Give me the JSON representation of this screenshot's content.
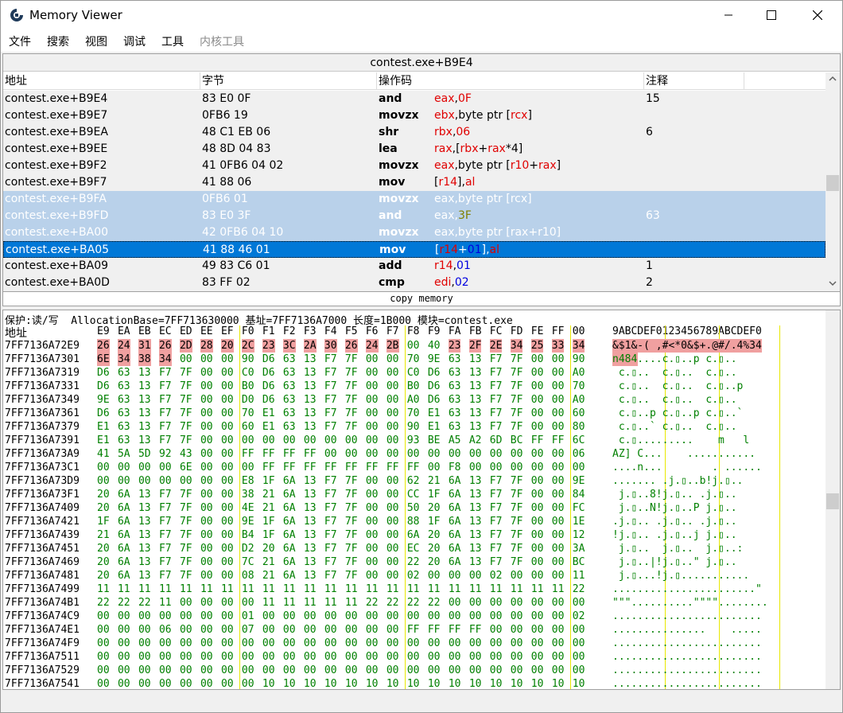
{
  "window": {
    "title": "Memory Viewer"
  },
  "menu": [
    "文件",
    "搜索",
    "视图",
    "调试",
    "工具",
    "内核工具"
  ],
  "disasm": {
    "address_header": "contest.exe+B9E4",
    "columns": [
      "地址",
      "字节",
      "操作码",
      "注释"
    ],
    "rows": [
      {
        "addr": "contest.exe+B9E4",
        "bytes": "83 E0 0F",
        "op": "and",
        "args": [
          [
            "eax",
            "reg"
          ],
          [
            ",",
            ""
          ],
          [
            "0F",
            "reg"
          ]
        ],
        "comment": "15",
        "state": ""
      },
      {
        "addr": "contest.exe+B9E7",
        "bytes": "0FB6 19",
        "op": "movzx",
        "args": [
          [
            "ebx",
            "reg"
          ],
          [
            ",byte ptr [",
            ""
          ],
          [
            "rcx",
            "reg"
          ],
          [
            "]",
            ""
          ]
        ],
        "comment": "",
        "state": ""
      },
      {
        "addr": "contest.exe+B9EA",
        "bytes": "48 C1 EB 06",
        "op": "shr",
        "args": [
          [
            "rbx",
            "reg"
          ],
          [
            ",",
            ""
          ],
          [
            "06",
            "reg"
          ]
        ],
        "comment": "6",
        "state": ""
      },
      {
        "addr": "contest.exe+B9EE",
        "bytes": "48 8D 04 83",
        "op": "lea",
        "args": [
          [
            "rax",
            "reg"
          ],
          [
            ",[",
            ""
          ],
          [
            "rbx",
            "reg"
          ],
          [
            "+",
            ""
          ],
          [
            "rax",
            "reg"
          ],
          [
            "*4]",
            ""
          ]
        ],
        "comment": "",
        "state": ""
      },
      {
        "addr": "contest.exe+B9F2",
        "bytes": "41 0FB6 04 02",
        "op": "movzx",
        "args": [
          [
            "eax",
            "reg"
          ],
          [
            ",byte ptr [",
            ""
          ],
          [
            "r10",
            "reg"
          ],
          [
            "+",
            ""
          ],
          [
            "rax",
            "reg"
          ],
          [
            "]",
            ""
          ]
        ],
        "comment": "",
        "state": ""
      },
      {
        "addr": "contest.exe+B9F7",
        "bytes": "41 88 06",
        "op": "mov",
        "args": [
          [
            "[",
            ""
          ],
          [
            "r14",
            "reg"
          ],
          [
            "],",
            ""
          ],
          [
            "al",
            "reg"
          ]
        ],
        "comment": "",
        "state": ""
      },
      {
        "addr": "contest.exe+B9FA",
        "bytes": "0FB6 01",
        "op": "movzx",
        "args": [
          [
            "eax",
            "reg"
          ],
          [
            ",byte ptr [",
            ""
          ],
          [
            "rcx",
            "reg"
          ],
          [
            "]",
            ""
          ]
        ],
        "comment": "",
        "state": "sel"
      },
      {
        "addr": "contest.exe+B9FD",
        "bytes": "83 E0 3F",
        "op": "and",
        "args": [
          [
            "eax",
            "reg"
          ],
          [
            ",",
            ""
          ],
          [
            "3F",
            "imm"
          ]
        ],
        "comment": "63",
        "state": "sel"
      },
      {
        "addr": "contest.exe+BA00",
        "bytes": "42 0FB6 04 10",
        "op": "movzx",
        "args": [
          [
            "eax",
            "reg"
          ],
          [
            ",byte ptr [",
            ""
          ],
          [
            "rax",
            "reg"
          ],
          [
            "+",
            ""
          ],
          [
            "r10",
            "reg"
          ],
          [
            "]",
            ""
          ]
        ],
        "comment": "",
        "state": "sel"
      },
      {
        "addr": "contest.exe+BA05",
        "bytes": "41 88 46 01",
        "op": "mov",
        "args": [
          [
            "[",
            ""
          ],
          [
            "r14",
            "reg"
          ],
          [
            "+",
            ""
          ],
          [
            "01",
            "num"
          ],
          [
            "],",
            ""
          ],
          [
            "al",
            "reg"
          ]
        ],
        "comment": "",
        "state": "cur"
      },
      {
        "addr": "contest.exe+BA09",
        "bytes": "49 83 C6 01",
        "op": "add",
        "args": [
          [
            "r14",
            "reg"
          ],
          [
            ",",
            ""
          ],
          [
            "01",
            "num"
          ]
        ],
        "comment": "1",
        "state": ""
      },
      {
        "addr": "contest.exe+BA0D",
        "bytes": "83 FF 02",
        "op": "cmp",
        "args": [
          [
            "edi",
            "reg"
          ],
          [
            ",",
            ""
          ],
          [
            "02",
            "num"
          ]
        ],
        "comment": "2",
        "state": ""
      }
    ],
    "copy_memory": "copy memory"
  },
  "hex": {
    "info": "保护:读/写  AllocationBase=7FF713630000 基址=7FF7136A7000 长度=1B000 模块=contest.exe",
    "addr_label": "地址",
    "col_labels": [
      "E9",
      "EA",
      "EB",
      "EC",
      "ED",
      "EE",
      "EF",
      "F0",
      "F1",
      "F2",
      "F3",
      "F4",
      "F5",
      "F6",
      "F7",
      "F8",
      "F9",
      "FA",
      "FB",
      "FC",
      "FD",
      "FE",
      "FF",
      "00"
    ],
    "ascii_header": "9ABCDEF0123456789ABCDEF0",
    "rows": [
      {
        "addr": "7FF7136A72E9",
        "bytes": "26 24 31 26 2D 28 20 2C 23 3C 2A 30 26 24 2B 00 40 23 2F 2E 34 25 33 34",
        "ascii": "&$1&-( ,#<*0&$+.@#/.4%34",
        "chg": [
          0,
          1,
          2,
          3,
          4,
          5,
          6,
          7,
          8,
          9,
          10,
          11,
          12,
          13,
          14,
          17,
          18,
          19,
          20,
          21,
          22,
          23
        ]
      },
      {
        "addr": "7FF7136A7301",
        "bytes": "6E 34 38 34 00 00 00 90 D6 63 13 F7 7F 00 00 70 9E 63 13 F7 7F 00 00 90",
        "ascii": "n484....c.▯..p c.▯..",
        "chg": [
          0,
          1,
          2,
          3
        ]
      },
      {
        "addr": "7FF7136A7319",
        "bytes": "D6 63 13 F7 7F 00 00 C0 D6 63 13 F7 7F 00 00 C0 D6 63 13 F7 7F 00 00 A0",
        "ascii": " c.▯..  c.▯..  c.▯..",
        "chg": []
      },
      {
        "addr": "7FF7136A7331",
        "bytes": "D6 63 13 F7 7F 00 00 B0 D6 63 13 F7 7F 00 00 B0 D6 63 13 F7 7F 00 00 70",
        "ascii": " c.▯..  c.▯..  c.▯..p",
        "chg": []
      },
      {
        "addr": "7FF7136A7349",
        "bytes": "9E 63 13 F7 7F 00 00 D0 D6 63 13 F7 7F 00 00 A0 D6 63 13 F7 7F 00 00 A0",
        "ascii": " c.▯..  c.▯..  c.▯..",
        "chg": []
      },
      {
        "addr": "7FF7136A7361",
        "bytes": "D6 63 13 F7 7F 00 00 70 E1 63 13 F7 7F 00 00 70 E1 63 13 F7 7F 00 00 60",
        "ascii": " c.▯..p c.▯..p c.▯..`",
        "chg": []
      },
      {
        "addr": "7FF7136A7379",
        "bytes": "E1 63 13 F7 7F 00 00 60 E1 63 13 F7 7F 00 00 90 E1 63 13 F7 7F 00 00 80",
        "ascii": " c.▯..` c.▯..  c.▯..",
        "chg": []
      },
      {
        "addr": "7FF7136A7391",
        "bytes": "E1 63 13 F7 7F 00 00 00 00 00 00 00 00 00 00 93 BE A5 A2 6D BC FF FF 6C",
        "ascii": " c.▯.........    m   l",
        "chg": []
      },
      {
        "addr": "7FF7136A73A9",
        "bytes": "41 5A 5D 92 43 00 00 FF FF FF FF 00 00 00 00 00 00 00 00 00 00 00 00 06",
        "ascii": "AZ] C...    ...........",
        "chg": []
      },
      {
        "addr": "7FF7136A73C1",
        "bytes": "00 00 00 00 6E 00 00 00 FF FF FF FF FF FF FF FF 00 F8 00 00 00 00 00 00",
        "ascii": "....n...        . ......",
        "chg": []
      },
      {
        "addr": "7FF7136A73D9",
        "bytes": "00 00 00 00 00 00 00 E8 1F 6A 13 F7 7F 00 00 62 21 6A 13 F7 7F 00 00 9E",
        "ascii": "....... .j.▯..b!j.▯..",
        "chg": []
      },
      {
        "addr": "7FF7136A73F1",
        "bytes": "20 6A 13 F7 7F 00 00 38 21 6A 13 F7 7F 00 00 CC 1F 6A 13 F7 7F 00 00 84",
        "ascii": " j.▯..8!j.▯.. .j.▯..",
        "chg": []
      },
      {
        "addr": "7FF7136A7409",
        "bytes": "20 6A 13 F7 7F 00 00 4E 21 6A 13 F7 7F 00 00 50 20 6A 13 F7 7F 00 00 FC",
        "ascii": " j.▯..N!j.▯..P j.▯..",
        "chg": []
      },
      {
        "addr": "7FF7136A7421",
        "bytes": "1F 6A 13 F7 7F 00 00 9E 1F 6A 13 F7 7F 00 00 88 1F 6A 13 F7 7F 00 00 1E",
        "ascii": ".j.▯.. .j.▯.. .j.▯..",
        "chg": []
      },
      {
        "addr": "7FF7136A7439",
        "bytes": "21 6A 13 F7 7F 00 00 B4 1F 6A 13 F7 7F 00 00 6A 20 6A 13 F7 7F 00 00 12",
        "ascii": "!j.▯.. .j.▯..j j.▯..",
        "chg": []
      },
      {
        "addr": "7FF7136A7451",
        "bytes": "20 6A 13 F7 7F 00 00 D2 20 6A 13 F7 7F 00 00 EC 20 6A 13 F7 7F 00 00 3A",
        "ascii": " j.▯..  j.▯..  j.▯..:",
        "chg": []
      },
      {
        "addr": "7FF7136A7469",
        "bytes": "20 6A 13 F7 7F 00 00 7C 21 6A 13 F7 7F 00 00 22 20 6A 13 F7 7F 00 00 BC",
        "ascii": " j.▯..|!j.▯..\" j.▯..",
        "chg": []
      },
      {
        "addr": "7FF7136A7481",
        "bytes": "20 6A 13 F7 7F 00 00 08 21 6A 13 F7 7F 00 00 02 00 00 00 02 00 00 00 11",
        "ascii": " j.▯...!j.▯...........",
        "chg": []
      },
      {
        "addr": "7FF7136A7499",
        "bytes": "11 11 11 11 11 11 11 11 11 11 11 11 11 11 11 11 11 11 11 11 11 11 11 22",
        "ascii": ".......................\"",
        "chg": []
      },
      {
        "addr": "7FF7136A74B1",
        "bytes": "22 22 22 11 00 00 00 00 11 11 11 11 11 22 22 22 22 00 00 00 00 00 00 00",
        "ascii": "\"\"\"..........\"\"\"\"........",
        "chg": []
      },
      {
        "addr": "7FF7136A74C9",
        "bytes": "00 00 00 00 00 00 00 01 00 00 00 00 00 00 00 00 00 00 00 00 00 00 00 02",
        "ascii": "........................",
        "chg": []
      },
      {
        "addr": "7FF7136A74E1",
        "bytes": "00 00 00 06 00 00 00 07 00 00 00 00 00 00 00 FF FF FF FF 00 00 00 00 00",
        "ascii": "...............    .....",
        "chg": []
      },
      {
        "addr": "7FF7136A74F9",
        "bytes": "00 00 00 00 00 00 00 00 00 00 00 00 00 00 00 00 00 00 00 00 00 00 00 00",
        "ascii": "........................",
        "chg": []
      },
      {
        "addr": "7FF7136A7511",
        "bytes": "00 00 00 00 00 00 00 00 00 00 00 00 00 00 00 00 00 00 00 00 00 00 00 00",
        "ascii": "........................",
        "chg": []
      },
      {
        "addr": "7FF7136A7529",
        "bytes": "00 00 00 00 00 00 00 00 00 00 00 00 00 00 00 00 00 00 00 00 00 00 00 00",
        "ascii": "........................",
        "chg": []
      },
      {
        "addr": "7FF7136A7541",
        "bytes": "00 00 00 00 00 00 00 00 10 10 10 10 10 10 10 10 10 10 10 10 10 10 10 10",
        "ascii": "........................",
        "chg": []
      }
    ]
  },
  "colors": {
    "selection": "#b9d1ea",
    "current": "#0078d7",
    "changed": "#f0a0a0",
    "hex_green": "#008000",
    "register_red": "#e00000"
  }
}
